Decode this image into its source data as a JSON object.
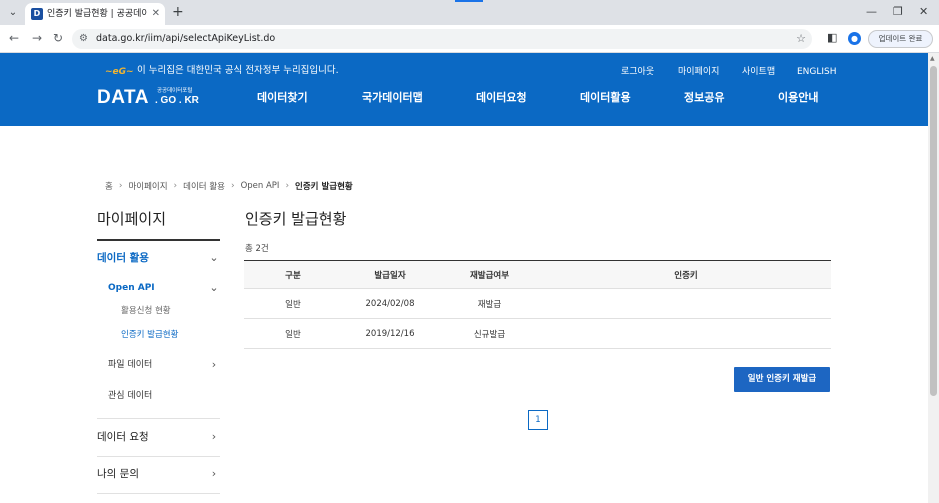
{
  "browser": {
    "tab_title": "인증키 발급현황 | 공공데이터포",
    "tab_favicon": "D",
    "tab_close": "✕",
    "new_tab": "+",
    "url": "data.go.kr/iim/api/selectApiKeyList.do",
    "update_button": "업데이트 완료",
    "icons": {
      "tab_menu": "chevron-down-icon",
      "back": "arrow-left-icon",
      "forward": "arrow-right-icon",
      "reload": "reload-icon",
      "site_info": "tune-icon",
      "bookmark": "star-icon",
      "side_panel": "side-panel-icon",
      "profile": "person-icon"
    }
  },
  "header": {
    "gov_mark": "~eG~",
    "gov_text": "이 누리집은 대한민국 공식 전자정부 누리집입니다.",
    "utility_links": [
      "로그아웃",
      "마이페이지",
      "사이트맵",
      "ENGLISH"
    ],
    "logo_main": "DATA",
    "logo_sub_top": "공공데이터포털",
    "logo_sub_bottom": ". GO . KR",
    "gnb": [
      "데이터찾기",
      "국가데이터맵",
      "데이터요청",
      "데이터활용",
      "정보공유",
      "이용안내"
    ],
    "colors": {
      "header_bg": "#0b69c4",
      "gov_mark": "#f2b531"
    }
  },
  "breadcrumb": {
    "home": "홈",
    "items": [
      "마이페이지",
      "데이터 활용",
      "Open API"
    ],
    "current": "인증키 발급현황"
  },
  "sidebar": {
    "title": "마이페이지",
    "section_data_use": "데이터 활용",
    "open_api": "Open API",
    "open_api_children": [
      "활용신청 현황",
      "인증키 발급현황"
    ],
    "file_data": "파일 데이터",
    "interest_data": "관심 데이터",
    "data_request": "데이터 요청",
    "my_inquiry": "나의 문의"
  },
  "main": {
    "title": "인증키 발급현황",
    "total": "총 2건",
    "table": {
      "headers": [
        "구분",
        "발급일자",
        "재발급여부",
        "인증키"
      ],
      "rows": [
        [
          "일반",
          "2024/02/08",
          "재발급",
          ""
        ],
        [
          "일반",
          "2019/12/16",
          "신규발급",
          ""
        ]
      ]
    },
    "reissue_button": "일반 인증키 재발급",
    "pagination": [
      "1"
    ],
    "colors": {
      "accent": "#1d66c2"
    }
  }
}
